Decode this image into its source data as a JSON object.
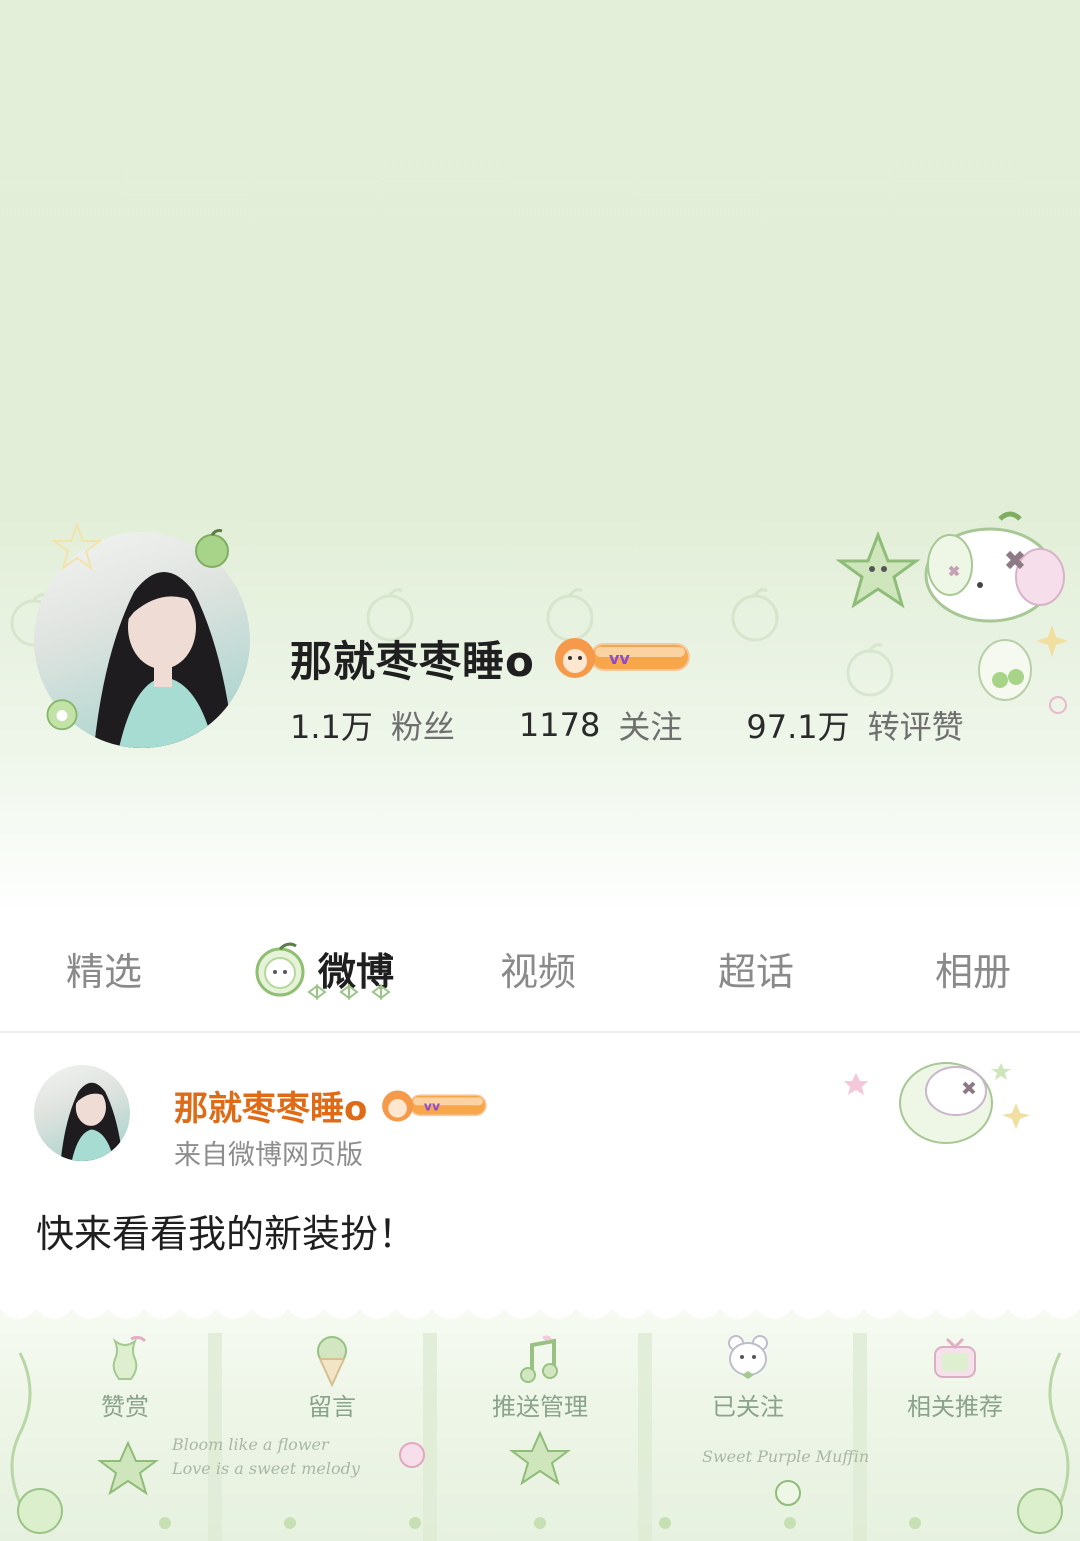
{
  "profile": {
    "name": "那就枣枣睡o",
    "badge_text": "vv",
    "stats": [
      {
        "value": "1.1万",
        "label": "粉丝"
      },
      {
        "value": "1178",
        "label": "关注"
      },
      {
        "value": "97.1万",
        "label": "转评赞"
      }
    ]
  },
  "tabs": [
    {
      "label": "精选",
      "active": false
    },
    {
      "label": "微博",
      "active": true
    },
    {
      "label": "视频",
      "active": false
    },
    {
      "label": "超话",
      "active": false
    },
    {
      "label": "相册",
      "active": false
    }
  ],
  "post": {
    "author": "那就枣枣睡o",
    "badge_text": "vv",
    "source": "来自微博网页版",
    "text": "快来看看我的新装扮！"
  },
  "actions": [
    {
      "label": "赞赏",
      "icon": "apple-core-icon"
    },
    {
      "label": "留言",
      "icon": "ice-cream-icon"
    },
    {
      "label": "推送管理",
      "icon": "music-note-icon"
    },
    {
      "label": "已关注",
      "icon": "bear-icon"
    },
    {
      "label": "相关推荐",
      "icon": "tv-icon"
    }
  ],
  "decor_text": {
    "script_left_1": "Bloom like a flower",
    "script_left_2": "Love is a sweet melody",
    "script_right": "Sweet Purple Muffin"
  },
  "colors": {
    "header_bg": "#e2eed7",
    "accent_orange": "#e06b16",
    "apple_green": "#a8d48a"
  }
}
